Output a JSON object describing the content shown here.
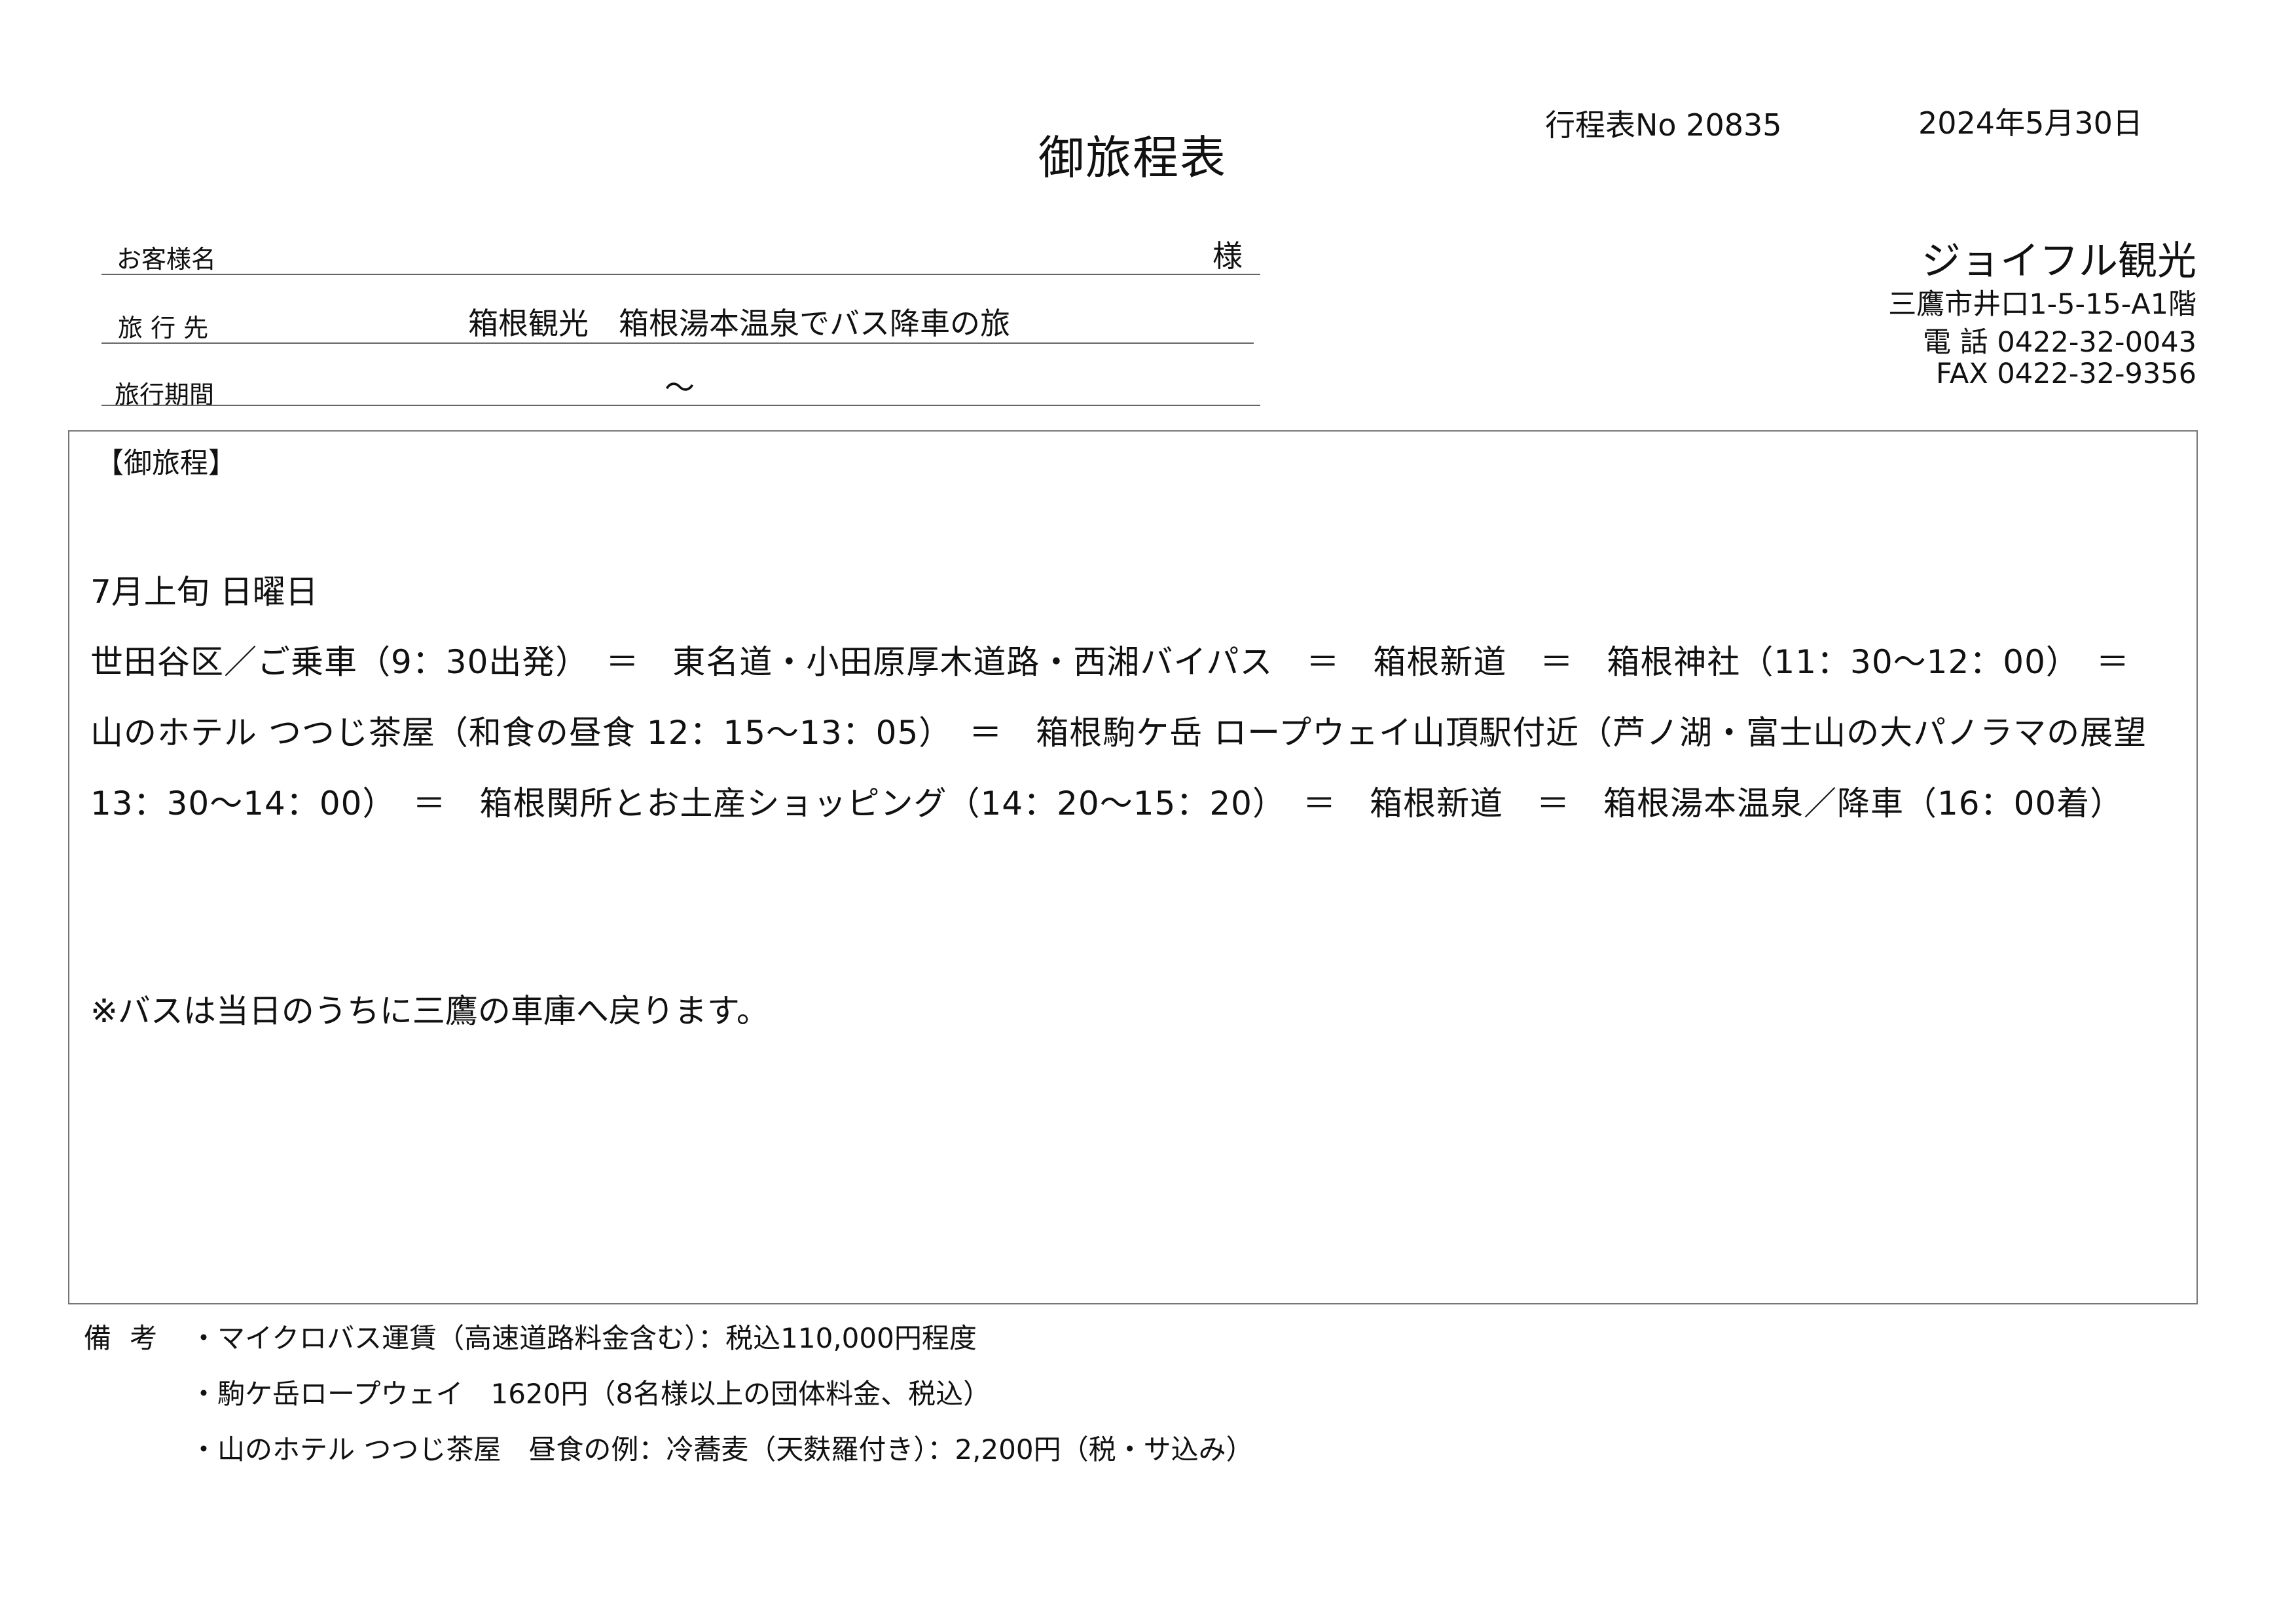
{
  "header": {
    "title": "御旅程表",
    "doc_no": "行程表No  20835",
    "date": "2024年5月30日"
  },
  "fields": {
    "customer_label": "お客様名",
    "customer_suffix": "様",
    "destination_label": "旅 行 先",
    "destination_value": "箱根観光　箱根湯本温泉でバス降車の旅",
    "period_label": "旅行期間",
    "period_value": "～"
  },
  "company": {
    "name": "ジョイフル観光",
    "address": "三鷹市井口1-5-15-A1階",
    "tel": "電 話 0422-32-0043",
    "fax": "FAX 0422-32-9356"
  },
  "itinerary": {
    "heading": "【御旅程】",
    "day": "7月上旬 日曜日",
    "route": "世田谷区／ご乗車（9：30出発）　＝　東名道・小田原厚木道路・西湘バイパス　＝　箱根新道　＝　箱根神社（11：30～12：00）　＝　山のホテル つつじ茶屋（和食の昼食 12：15～13：05）　＝　箱根駒ケ岳 ロープウェイ山頂駅付近（芦ノ湖・富士山の大パノラマの展望　13：30～14：00）　＝　箱根関所とお土産ショッピング（14：20～15：20）　＝　箱根新道　＝　箱根湯本温泉／降車（16：00着）",
    "note": "※バスは当日のうちに三鷹の車庫へ戻ります。"
  },
  "remarks": {
    "label": "備考",
    "items": [
      "・マイクロバス運賃（高速道路料金含む）：税込110,000円程度",
      "・駒ケ岳ロープウェイ　1620円（8名様以上の団体料金、税込）",
      "・山のホテル つつじ茶屋　昼食の例：冷蕎麦（天麩羅付き）：2,200円（税・サ込み）"
    ]
  }
}
